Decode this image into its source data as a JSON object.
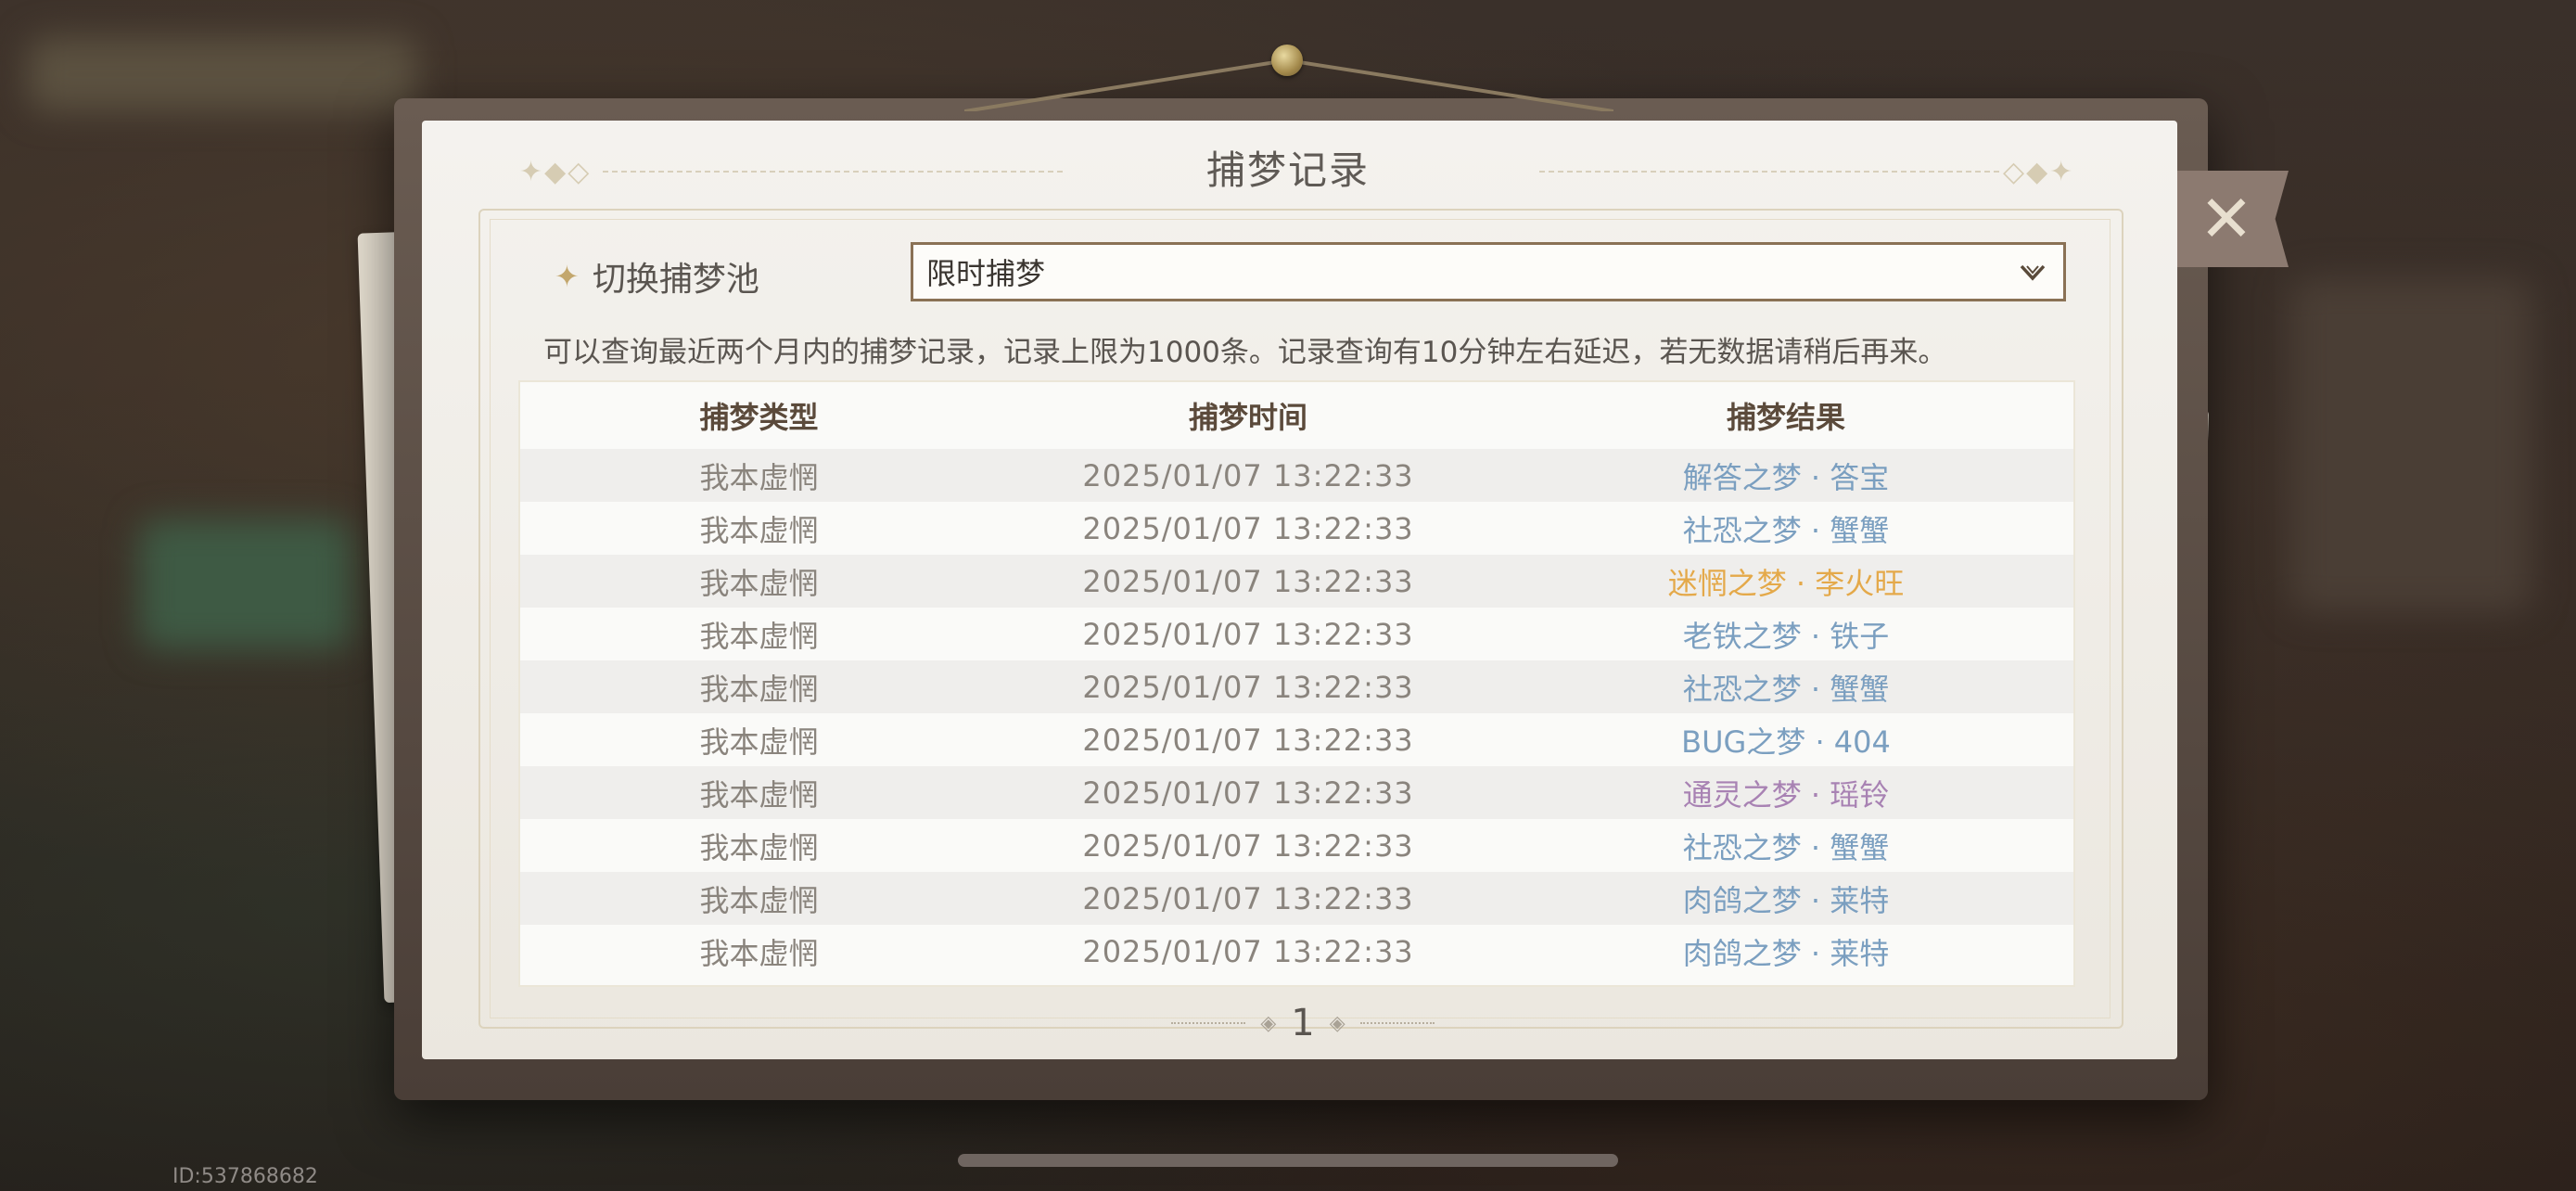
{
  "dialog": {
    "title": "捕梦记录",
    "switch_label": "切换捕梦池",
    "pool_select": {
      "value": "限时捕梦"
    },
    "notice": "可以查询最近两个月内的捕梦记录，记录上限为1000条。记录查询有10分钟左右延迟，若无数据请稍后再来。"
  },
  "table": {
    "headers": [
      "捕梦类型",
      "捕梦时间",
      "捕梦结果"
    ],
    "rows": [
      {
        "type": "我本虚惘",
        "time": "2025/01/07 13:22:33",
        "result": "解答之梦 · 答宝",
        "color": "blue"
      },
      {
        "type": "我本虚惘",
        "time": "2025/01/07 13:22:33",
        "result": "社恐之梦 · 蟹蟹",
        "color": "blue"
      },
      {
        "type": "我本虚惘",
        "time": "2025/01/07 13:22:33",
        "result": "迷惘之梦 · 李火旺",
        "color": "orange"
      },
      {
        "type": "我本虚惘",
        "time": "2025/01/07 13:22:33",
        "result": "老铁之梦 · 铁子",
        "color": "blue"
      },
      {
        "type": "我本虚惘",
        "time": "2025/01/07 13:22:33",
        "result": "社恐之梦 · 蟹蟹",
        "color": "blue"
      },
      {
        "type": "我本虚惘",
        "time": "2025/01/07 13:22:33",
        "result": "BUG之梦 · 404",
        "color": "blue"
      },
      {
        "type": "我本虚惘",
        "time": "2025/01/07 13:22:33",
        "result": "通灵之梦 · 瑶铃",
        "color": "purple"
      },
      {
        "type": "我本虚惘",
        "time": "2025/01/07 13:22:33",
        "result": "社恐之梦 · 蟹蟹",
        "color": "blue"
      },
      {
        "type": "我本虚惘",
        "time": "2025/01/07 13:22:33",
        "result": "肉鸽之梦 · 莱特",
        "color": "blue"
      },
      {
        "type": "我本虚惘",
        "time": "2025/01/07 13:22:33",
        "result": "肉鸽之梦 · 莱特",
        "color": "blue"
      }
    ]
  },
  "pagination": {
    "current_page": "1"
  },
  "footer": {
    "uid": "ID:537868682"
  },
  "icons": {
    "close": "close-icon",
    "select_arrow": "chevron-down-icon",
    "label_star": "star-icon",
    "pager": "diamond-icon"
  },
  "colors": {
    "result_blue": "#7b9fc0",
    "result_orange": "#e4a94a",
    "result_purple": "#a882b3",
    "select_border": "#8a7155"
  }
}
